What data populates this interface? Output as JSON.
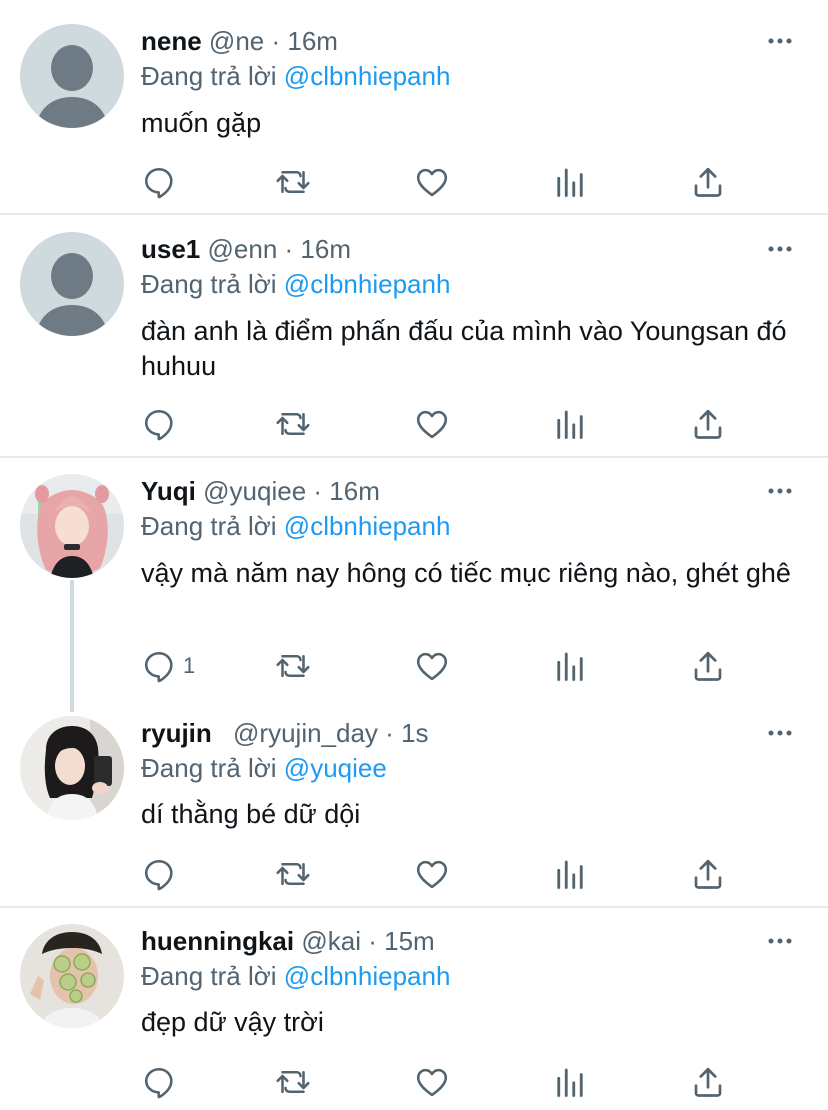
{
  "tweets": [
    {
      "name": "nene",
      "handle": "@ne",
      "dot": "·",
      "time": "16m",
      "reply_prefix": "Đang trả lời",
      "reply_mention": "@clbnhiepanh",
      "text": "muốn gặp",
      "reply_count": "",
      "avatar": "default-avatar"
    },
    {
      "name": "use1",
      "handle": "@enn",
      "dot": "·",
      "time": "16m",
      "reply_prefix": "Đang trả lời",
      "reply_mention": "@clbnhiepanh",
      "text": "đàn anh là điểm phấn đấu của mình vào Youngsan đó huhuu",
      "reply_count": "",
      "avatar": "default-avatar"
    },
    {
      "name": "Yuqi",
      "handle": "@yuqiee",
      "dot": "·",
      "time": "16m",
      "reply_prefix": "Đang trả lời",
      "reply_mention": "@clbnhiepanh",
      "text": "vậy mà năm nay hông có tiếc mục riêng nào, ghét ghê",
      "reply_count": "1",
      "avatar": "photo-avatar-pink-hair"
    },
    {
      "name": "ryujin",
      "handle": "@ryujin_day",
      "dot": "·",
      "time": "1s",
      "reply_prefix": "Đang trả lời",
      "reply_mention": "@yuqiee",
      "text": "dí thằng bé dữ dội",
      "reply_count": "",
      "avatar": "photo-avatar-dark-hair"
    },
    {
      "name": "huenningkai",
      "handle": "@kai",
      "dot": "·",
      "time": "15m",
      "reply_prefix": "Đang trả lời",
      "reply_mention": "@clbnhiepanh",
      "text": "đẹp dữ vậy trời",
      "reply_count": "",
      "avatar": "photo-avatar-cucumber-mask"
    }
  ],
  "icons": {
    "more": "more-horizontal-icon",
    "reply": "reply-bubble-icon",
    "retweet": "retweet-icon",
    "like": "heart-icon",
    "stats": "bar-chart-icon",
    "share": "share-upload-icon"
  },
  "colors": {
    "text": "#0f1419",
    "secondary": "#536471",
    "accent": "#1d9bf0",
    "divider": "#e7e9ea",
    "default_avatar_bg": "#cfd9de",
    "default_avatar_fg": "#6e7b85"
  }
}
